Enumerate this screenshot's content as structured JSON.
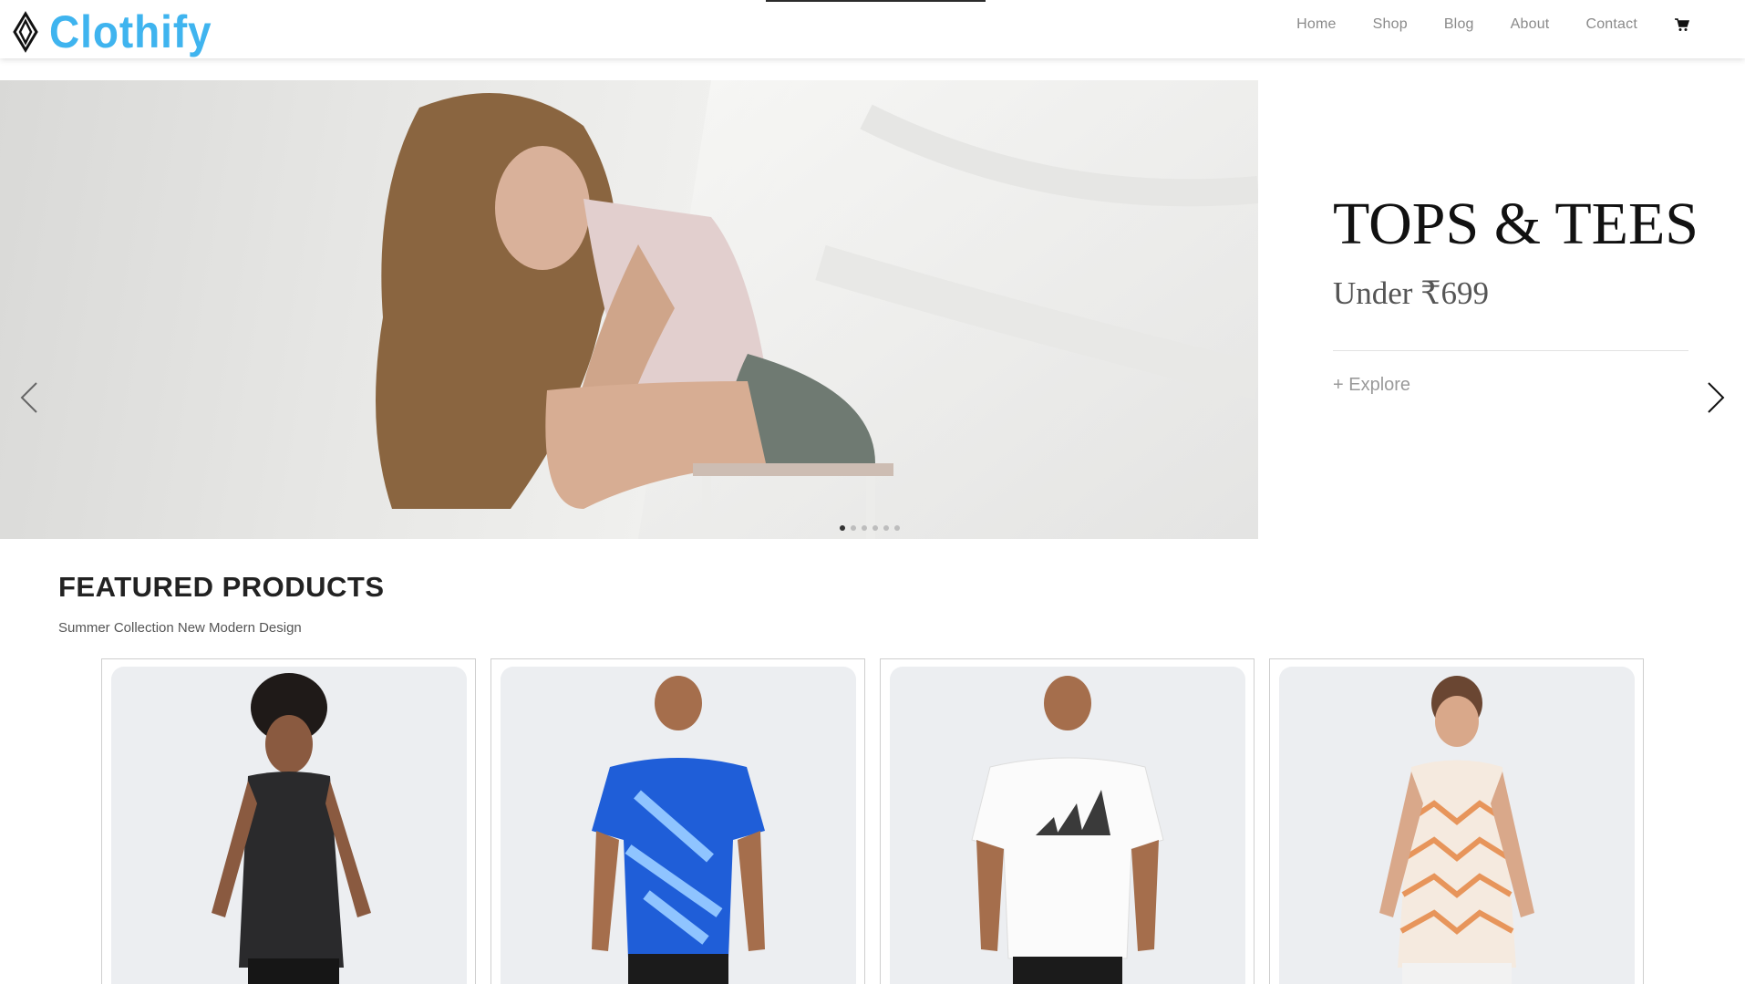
{
  "header": {
    "brand": "Clothify",
    "nav": [
      "Home",
      "Shop",
      "Blog",
      "About",
      "Contact"
    ]
  },
  "hero": {
    "title": "TOPS & TEES",
    "subtitle": "Under ₹699",
    "cta": "+ Explore",
    "slide_count": 6,
    "active_slide": 1
  },
  "featured": {
    "title": "FEATURED PRODUCTS",
    "subtitle": "Summer Collection New Modern Design"
  },
  "products": [
    {
      "image": "black sleeveless tank model"
    },
    {
      "image": "blue patterned tee model"
    },
    {
      "image": "white logo tee model"
    },
    {
      "image": "orange chevron singlet model"
    }
  ],
  "colors": {
    "brand": "#3fb4ef",
    "nav_text": "#8a8a8a",
    "card_bg": "#eceef1"
  }
}
